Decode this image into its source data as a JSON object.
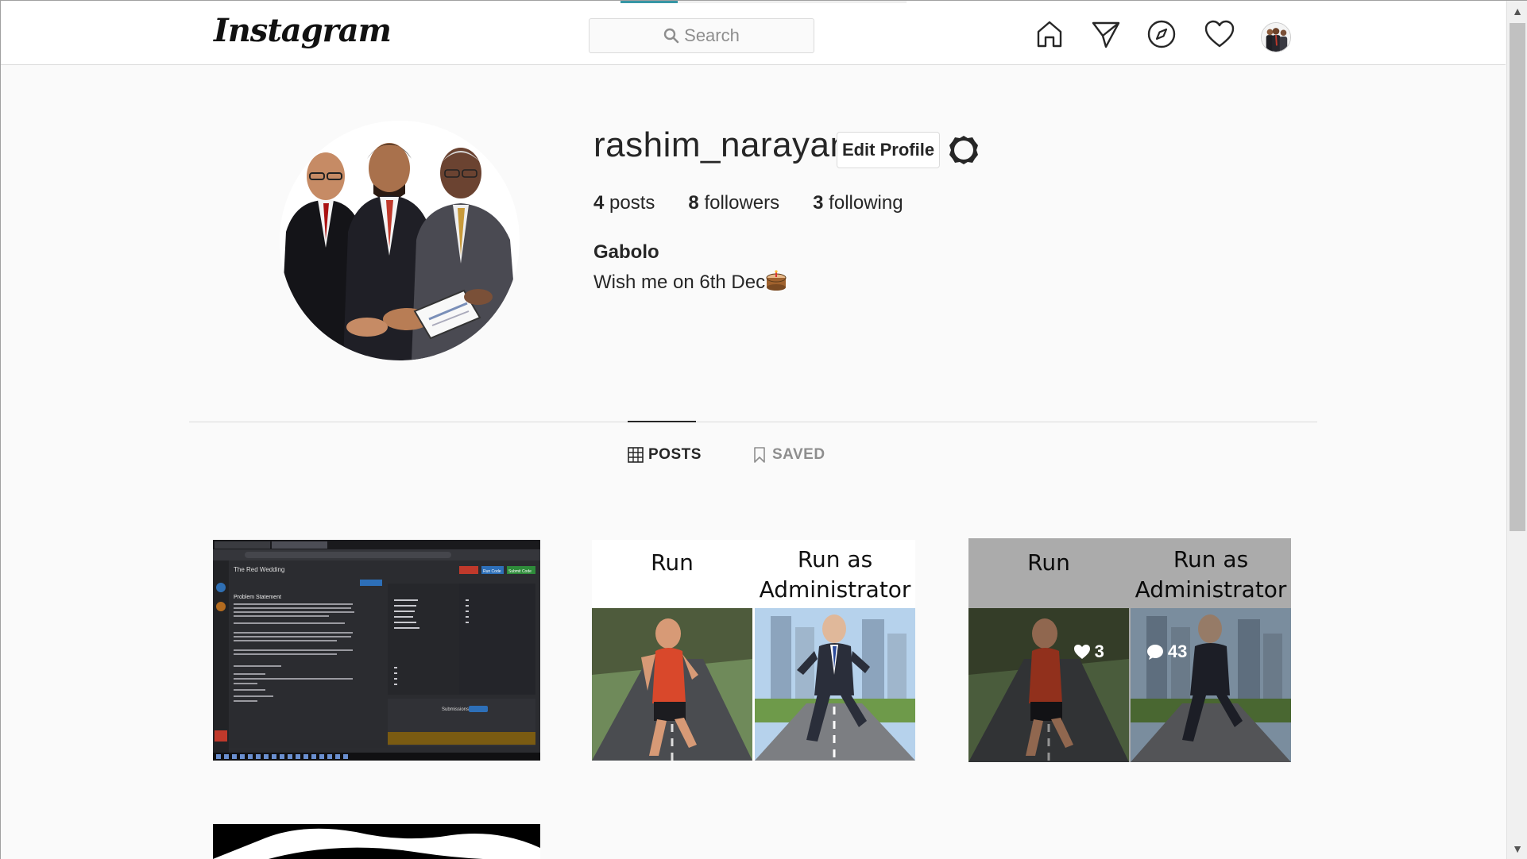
{
  "nav": {
    "logo": "Instagram",
    "search_placeholder": "Search",
    "icons": [
      "home-icon",
      "direct-icon",
      "explore-icon",
      "activity-icon",
      "profile-avatar"
    ],
    "loading_progress": 0.2
  },
  "profile": {
    "username": "rashim_narayan",
    "edit_label": "Edit Profile",
    "stats": {
      "posts_count": "4",
      "posts_label": "posts",
      "followers_count": "8",
      "followers_label": "followers",
      "following_count": "3",
      "following_label": "following"
    },
    "full_name": "Gabolo",
    "bio": "Wish me on 6th Dec"
  },
  "tabs": {
    "posts": "POSTS",
    "saved": "SAVED"
  },
  "posts": [
    {
      "kind": "screenshot",
      "title": "The Red Wedding",
      "section": "Problem Statement",
      "run": "Run Code",
      "submit": "Submit Code",
      "submissions": "Submissions"
    },
    {
      "kind": "meme",
      "left": "Run",
      "right": "Run as Administrator"
    },
    {
      "kind": "meme",
      "left": "Run",
      "right": "Run as Administrator",
      "likes": "3",
      "comments": "43"
    }
  ],
  "colors": {
    "accent": "#3897a6",
    "text": "#262626",
    "muted": "#8e8e8e",
    "border": "#dbdbdb"
  }
}
